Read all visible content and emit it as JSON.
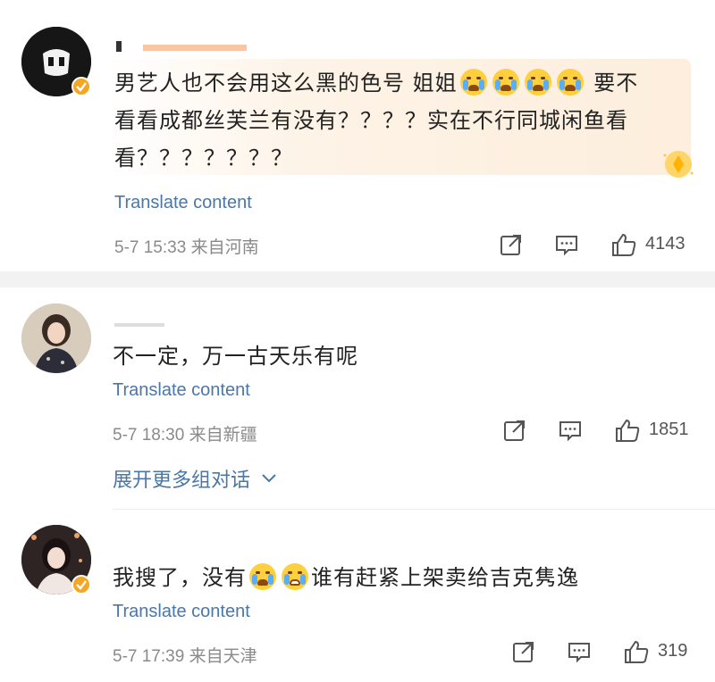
{
  "colors": {
    "link": "#4a77a8",
    "meta": "#8a8a8a",
    "badge": "#f5a623",
    "divider": "#f2f2f2"
  },
  "comments": [
    {
      "text_line1": "男艺人也不会用这么黑的色号 姐姐",
      "text_line1_tail": "要不",
      "text_line2": "看看成都丝芙兰有没有？？？？实在不行同城闲鱼看",
      "text_line3": "看？？？？？？？",
      "emojis": [
        "crying-emoji",
        "crying-emoji",
        "crying-emoji",
        "crying-emoji"
      ],
      "translate": "Translate content",
      "time": "5-7 15:33",
      "location": "来自河南",
      "likes": "4143",
      "verified": true
    },
    {
      "text": "不一定，万一古天乐有呢",
      "translate": "Translate content",
      "time": "5-7 18:30",
      "location": "来自新疆",
      "likes": "1851",
      "verified": false,
      "expand": "展开更多组对话"
    },
    {
      "text_before": "我搜了，没有",
      "text_after": "谁有赶紧上架卖给吉克隽逸",
      "emojis": [
        "crying-emoji",
        "laughing-tears-emoji"
      ],
      "translate": "Translate content",
      "time": "5-7 17:39",
      "location": "来自天津",
      "likes": "319",
      "verified": true
    }
  ]
}
